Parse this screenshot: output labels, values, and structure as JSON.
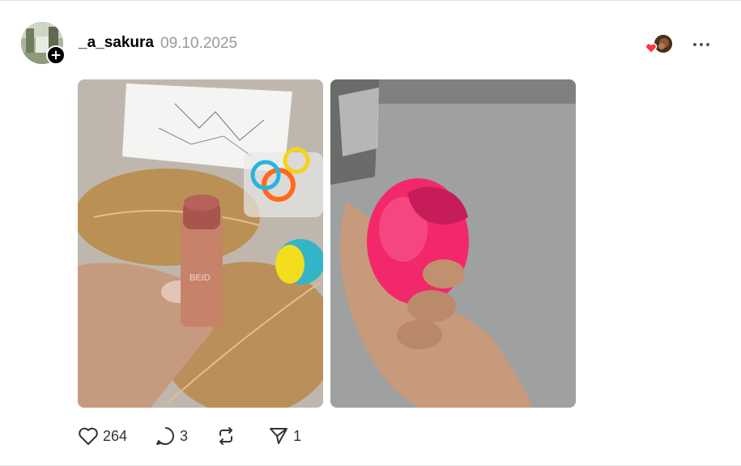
{
  "post": {
    "username": "_a_sakura",
    "date": "09.10.2025",
    "avatar_icon": "avatar-photo",
    "follow_icon": "plus-icon",
    "reaction_icon": "heart-icon",
    "more_icon": "more-horizontal-icon",
    "images": [
      {
        "subject": "peach cream blush stick held in hand over gold leaf placemat"
      },
      {
        "subject": "pink makeup sponge held in hand"
      }
    ],
    "actions": {
      "likes": "264",
      "comments": "3",
      "reposts": "",
      "shares": "1"
    }
  },
  "colors": {
    "text": "#000000",
    "muted": "#999999",
    "heart_red": "#ff3040",
    "border": "#e4e4e4"
  }
}
